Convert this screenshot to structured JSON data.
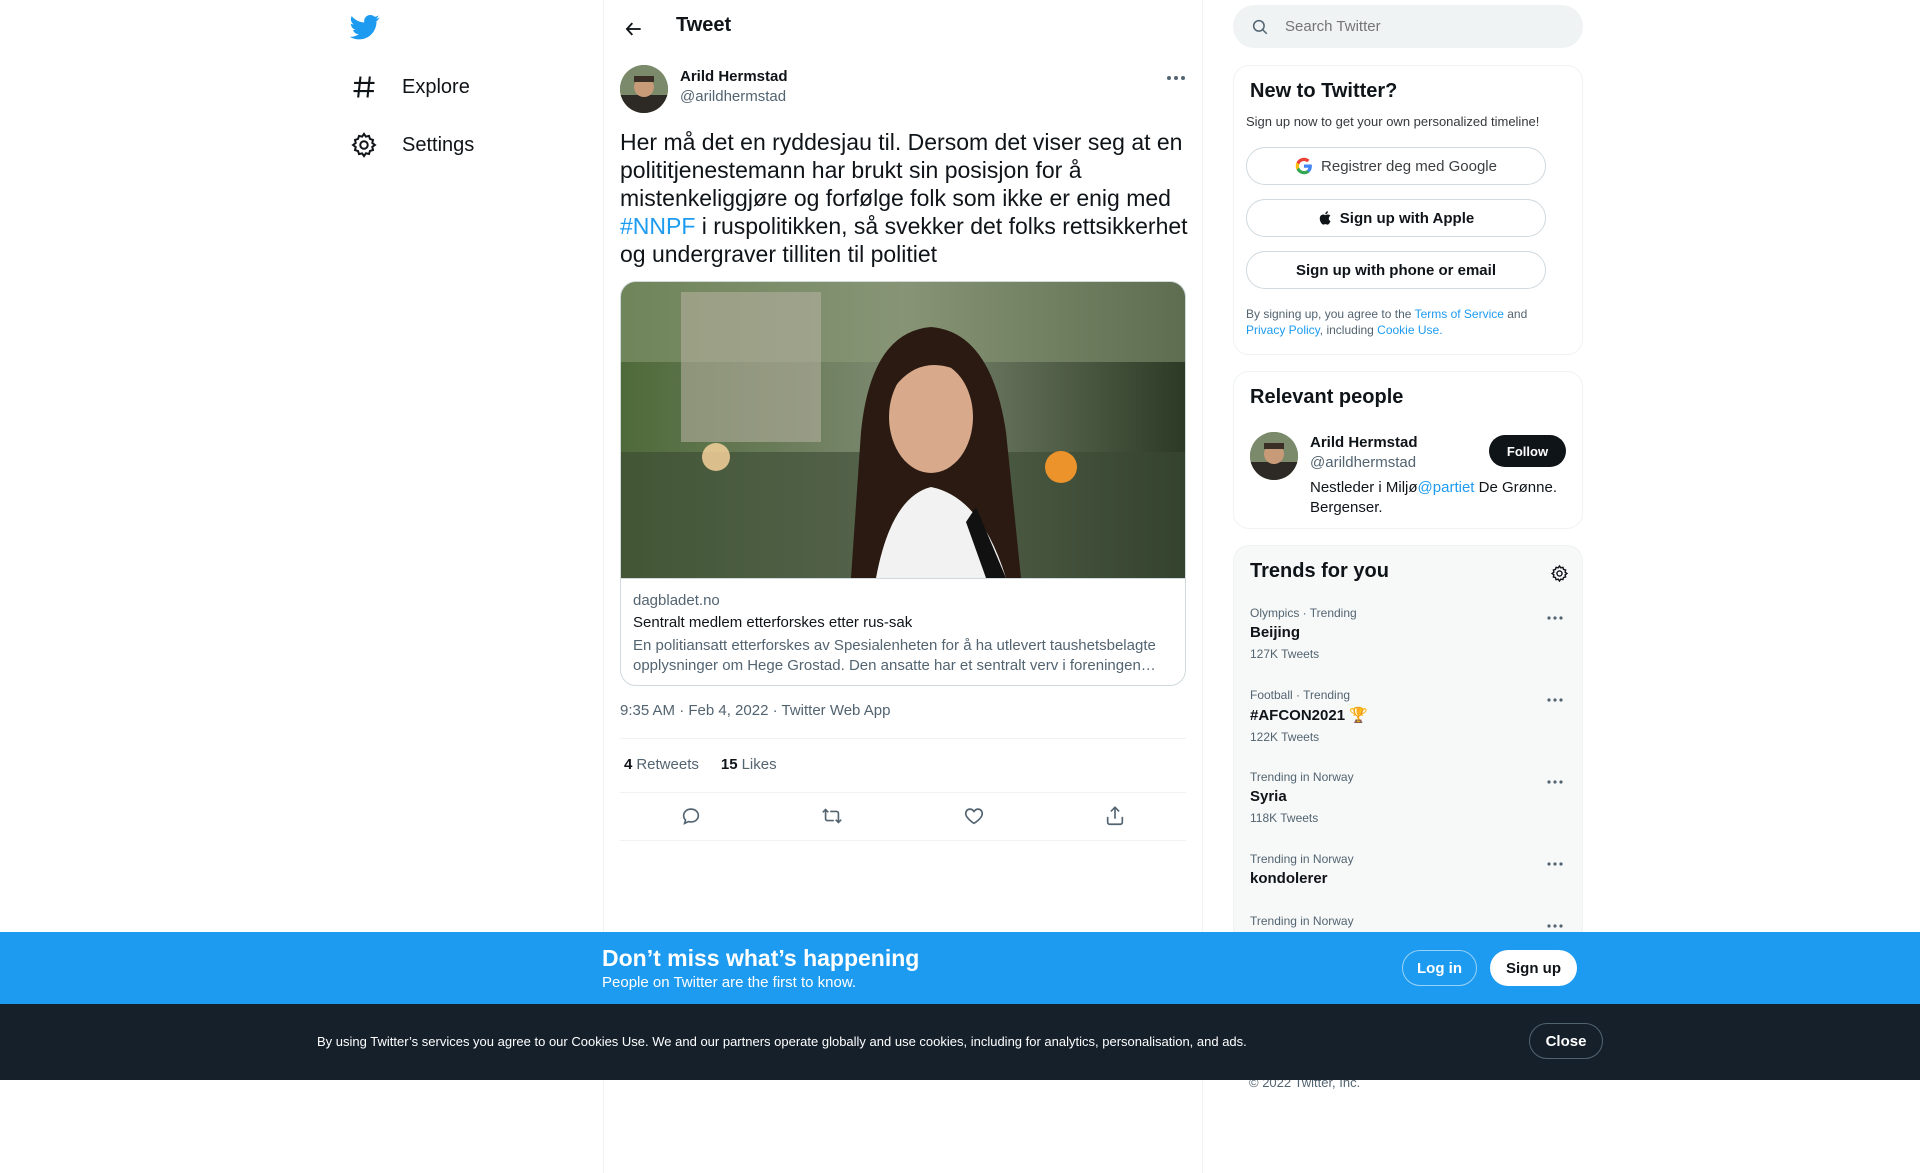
{
  "nav": {
    "logo_icon": "twitter-bird-icon",
    "items": [
      {
        "label": "Explore",
        "icon": "hashtag-icon"
      },
      {
        "label": "Settings",
        "icon": "gear-icon"
      }
    ]
  },
  "header": {
    "back_icon": "arrow-left-icon",
    "title": "Tweet"
  },
  "tweet": {
    "author_name": "Arild Hermstad",
    "author_handle": "@arildhermstad",
    "text_before": "Her må det en ryddesjau til. Dersom det viser seg at en polititjenestemann har brukt sin posisjon for å mistenkeliggjøre og forfølge folk som ikke er enig med ",
    "hashtag": "#NNPF",
    "text_after": " i ruspolitikken, så svekker det folks rettsikkerhet og undergraver tilliten til politiet",
    "card": {
      "domain": "dagbladet.no",
      "title": "Sentralt medlem etterforskes etter rus-sak",
      "description": "En politiansatt etterforskes av Spesialenheten for å ha utlevert taushetsbelagte opplysninger om Hege Grostad. Den ansatte har et sentralt verv i foreningen som står bak Ruskampanjen."
    },
    "meta": "9:35 AM · Feb 4, 2022 · Twitter Web App",
    "retweets_count": "4",
    "retweets_label": "Retweets",
    "likes_count": "15",
    "likes_label": "Likes",
    "actions": [
      "reply-icon",
      "retweet-icon",
      "like-icon",
      "share-icon"
    ]
  },
  "search": {
    "placeholder": "Search Twitter"
  },
  "signup_panel": {
    "title": "New to Twitter?",
    "subtitle": "Sign up now to get your own personalized timeline!",
    "google_label": "Registrer deg med Google",
    "apple_label": "Sign up with Apple",
    "phone_label": "Sign up with phone or email",
    "legal_1": "By signing up, you agree to the ",
    "terms": "Terms of Service",
    "legal_2": " and ",
    "privacy": "Privacy Policy",
    "legal_3": ", including ",
    "cookie_use": "Cookie Use."
  },
  "relevant_people": {
    "title": "Relevant people",
    "name": "Arild Hermstad",
    "handle": "@arildhermstad",
    "follow_label": "Follow",
    "bio_1": "Nestleder i Miljø",
    "bio_link": "@partiet",
    "bio_2": " De Grønne. Bergenser."
  },
  "trends": {
    "title": "Trends for you",
    "items": [
      {
        "category": "Olympics · Trending",
        "name": "Beijing",
        "count": "127K Tweets"
      },
      {
        "category": "Football · Trending",
        "name": "#AFCON2021 🏆",
        "count": "122K Tweets"
      },
      {
        "category": "Trending in Norway",
        "name": "Syria",
        "count": "118K Tweets"
      },
      {
        "category": "Trending in Norway",
        "name": "kondolerer",
        "count": ""
      },
      {
        "category": "Trending in Norway",
        "name": "",
        "count": ""
      }
    ]
  },
  "promo": {
    "headline": "Don’t miss what’s happening",
    "subline": "People on Twitter are the first to know.",
    "login_label": "Log in",
    "signup_label": "Sign up"
  },
  "cookie_bar": {
    "text": "By using Twitter’s services you agree to our Cookies Use. We and our partners operate globally and use cookies, including for analytics, personalisation, and ads.",
    "close_label": "Close"
  },
  "footer": {
    "copyright": "© 2022 Twitter, Inc."
  },
  "colors": {
    "brand_blue": "#1d9bf0",
    "text_primary": "#0f1419",
    "text_secondary": "#536471",
    "cookie_bg": "#15202b"
  }
}
